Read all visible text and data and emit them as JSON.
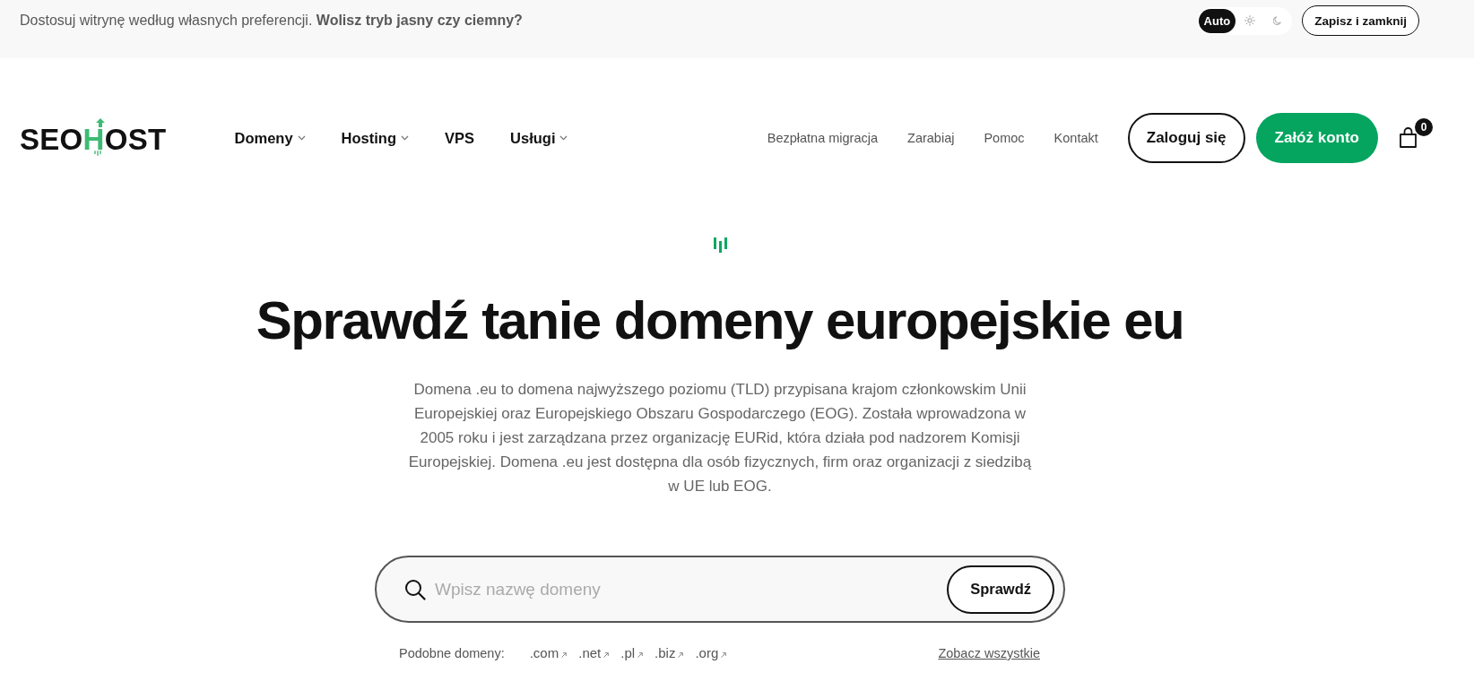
{
  "preferences_bar": {
    "text": "Dostosuj witrynę według własnych preferencji. **Wolisz tryb jasny czy ciemny?**",
    "theme_options": [
      {
        "kind": "auto",
        "label": "Auto",
        "selected": true
      },
      {
        "kind": "light",
        "selected": false
      },
      {
        "kind": "dark",
        "selected": false
      }
    ],
    "button": "Zapisz i zamknij"
  },
  "header": {
    "logo": {
      "prefix": "SEO",
      "accent": "H",
      "suffix": "OST"
    },
    "nav": [
      {
        "label": "Domeny",
        "has_dropdown": true
      },
      {
        "label": "Hosting",
        "has_dropdown": true
      },
      {
        "label": "VPS",
        "has_dropdown": false
      },
      {
        "label": "Usługi",
        "has_dropdown": true
      }
    ],
    "links": [
      "Bezpłatna migracja",
      "Zarabiaj",
      "Pomoc",
      "Kontakt"
    ],
    "login_button": "Zaloguj się",
    "signup_button": "Załóż konto",
    "cart": {
      "count": "0"
    }
  },
  "hero": {
    "title": "Sprawdź tanie domeny europejskie eu",
    "description": "Domena .eu to domena najwyższego poziomu (TLD) przypisana krajom członkowskim Unii Europejskiej oraz Europejskiego Obszaru Gospodarczego (EOG). Została wprowadzona w 2005 roku i jest zarządzana przez organizację EURid, która działa pod nadzorem Komisji Europejskiej. Domena .eu jest dostępna dla osób fizycznych, firm oraz organizacji z siedzibą w UE lub EOG.",
    "search": {
      "placeholder": "Wpisz nazwę domeny",
      "button": "Sprawdź"
    },
    "similar_domains": {
      "label": "Podobne domeny:",
      "domains": [
        ".com",
        ".net",
        ".pl",
        ".biz",
        ".org"
      ],
      "see_all": "Zobacz wszystkie"
    }
  }
}
